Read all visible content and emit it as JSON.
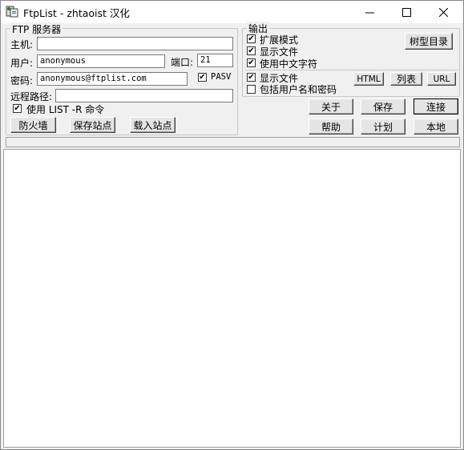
{
  "window": {
    "title": "FtpList - zhtaoist 汉化",
    "min_glyph": "—",
    "max_glyph": "☐",
    "close_glyph": "✕"
  },
  "ftp_server": {
    "group_title": "FTP 服务器",
    "host_label": "主机:",
    "host_value": "",
    "port_label": "端口:",
    "port_value": "21",
    "user_label": "用户:",
    "user_value": "anonymous",
    "password_label": "密码:",
    "password_value": "anonymous@ftplist.com",
    "pasv_label": "PASV",
    "pasv_checked": true,
    "remote_path_label": "远程路径:",
    "remote_path_value": "",
    "list_r_label": "使用 LIST -R 命令",
    "list_r_checked": true,
    "firewall_button": "防火墙",
    "save_site_button": "保存站点",
    "load_site_button": "载入站点"
  },
  "output": {
    "group_title": "输出",
    "extended_mode_label": "扩展模式",
    "extended_mode_checked": true,
    "show_files_label": "显示文件",
    "show_files_checked": true,
    "use_chinese_label": "使用中文字符",
    "use_chinese_checked": true,
    "show_files2_label": "显示文件",
    "show_files2_checked": true,
    "include_credentials_label": "包括用户名和密码",
    "include_credentials_checked": false,
    "tree_button": "树型目录",
    "html_button": "HTML",
    "list_button": "列表",
    "url_button": "URL"
  },
  "actions": {
    "about_button": "关于",
    "save_button": "保存",
    "connect_button": "连接",
    "help_button": "帮助",
    "schedule_button": "计划",
    "local_button": "本地"
  },
  "check_glyph": "✔"
}
